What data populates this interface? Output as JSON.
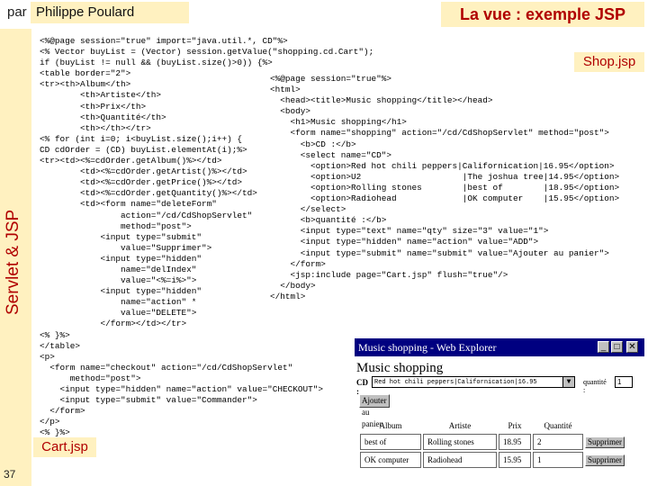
{
  "header": {
    "par": "par",
    "author": "Philippe Poulard",
    "title": "La vue : exemple JSP"
  },
  "sidebar": {
    "label": "Servlet & JSP",
    "page_number": "37"
  },
  "cart_code": "<%@page session=\"true\" import=\"java.util.*, CD\"%>\n<% Vector buyList = (Vector) session.getValue(\"shopping.cd.Cart\");\nif (buyList != null && (buyList.size()>0)) {%>\n<table border=\"2\">\n<tr><th>Album</th>\n        <th>Artiste</th>\n        <th>Prix</th>\n        <th>Quantité</th>\n        <th></th></tr>\n<% for (int i=0; i<buyList.size();i++) {\nCD cdOrder = (CD) buyList.elementAt(i);%>\n<tr><td><%=cdOrder.getAlbum()%></td>\n        <td><%=cdOrder.getArtist()%></td>\n        <td><%=cdOrder.getPrice()%></td>\n        <td><%=cdOrder.getQuantity()%></td>\n        <td><form name=\"deleteForm\"\n                action=\"/cd/CdShopServlet\"\n                method=\"post\">\n            <input type=\"submit\"\n                value=\"Supprimer\">\n            <input type=\"hidden\"\n                name=\"delIndex\"\n                value=\"<%=i%>\">\n            <input type=\"hidden\"\n                name=\"action\" *\n                value=\"DELETE\">\n            </form></td></tr>\n<% }%>\n</table>\n<p>\n  <form name=\"checkout\" action=\"/cd/CdShopServlet\"\n      method=\"post\">\n    <input type=\"hidden\" name=\"action\" value=\"CHECKOUT\">\n    <input type=\"submit\" value=\"Commander\">\n  </form>\n</p>\n<% }%>",
  "shop_code": "<%@page session=\"true\"%>\n<html>\n  <head><title>Music shopping</title></head>\n  <body>\n    <h1>Music shopping</h1>\n    <form name=\"shopping\" action=\"/cd/CdShopServlet\" method=\"post\">\n      <b>CD :</b>\n      <select name=\"CD\">\n        <option>Red hot chili peppers|Californication|16.95</option>\n        <option>U2                    |The joshua tree|14.95</option>\n        <option>Rolling stones        |best of        |18.95</option>\n        <option>Radiohead             |OK computer    |15.95</option>\n      </select>\n      <b>quantité :</b>\n      <input type=\"text\" name=\"qty\" size=\"3\" value=\"1\">\n      <input type=\"hidden\" name=\"action\" value=\"ADD\">\n      <input type=\"submit\" name=\"submit\" value=\"Ajouter au panier\">\n    </form>\n    <jsp:include page=\"Cart.jsp\" flush=\"true\"/>\n  </body>\n</html>",
  "tags": {
    "shop": "Shop.jsp",
    "cart": "Cart.jsp"
  },
  "browser": {
    "title": "Music shopping - Web Explorer",
    "heading": "Music shopping",
    "cd_label": "CD :",
    "selected_cd": "Red hot chili peppers|Californication|16.95",
    "qty_label": "quantité :",
    "qty_value": "1",
    "add_button": "Ajouter au panier",
    "columns": [
      "Album",
      "Artiste",
      "Prix",
      "Quantité"
    ],
    "rows": [
      {
        "album": "best of",
        "artist": "Rolling stones",
        "price": "18.95",
        "qty": "2",
        "action": "Supprimer"
      },
      {
        "album": "OK computer",
        "artist": "Radiohead",
        "price": "15.95",
        "qty": "1",
        "action": "Supprimer"
      }
    ],
    "buttons": {
      "minimize": "_",
      "maximize": "□",
      "close": "✕"
    }
  },
  "colors": {
    "accent": "#b00000",
    "label_bg": "#fff1c0",
    "titlebar": "#000080"
  }
}
